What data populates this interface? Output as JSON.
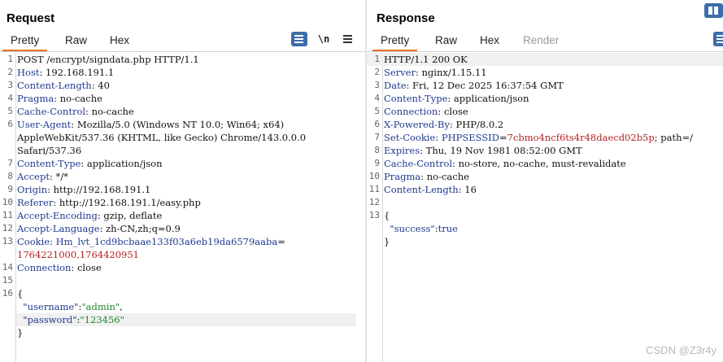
{
  "request": {
    "title": "Request",
    "tabs": [
      "Pretty",
      "Raw",
      "Hex"
    ],
    "newline_toggle": "\\n",
    "lines": [
      {
        "n": "1",
        "segments": [
          {
            "t": "POST /encrypt/signdata.php HTTP/1.1",
            "c": ""
          }
        ]
      },
      {
        "n": "2",
        "segments": [
          {
            "t": "Host",
            "c": "hn"
          },
          {
            "t": ": 192.168.191.1",
            "c": ""
          }
        ]
      },
      {
        "n": "3",
        "segments": [
          {
            "t": "Content-Length",
            "c": "hn"
          },
          {
            "t": ": 40",
            "c": ""
          }
        ]
      },
      {
        "n": "4",
        "segments": [
          {
            "t": "Pragma",
            "c": "hn"
          },
          {
            "t": ": no-cache",
            "c": ""
          }
        ]
      },
      {
        "n": "5",
        "segments": [
          {
            "t": "Cache-Control",
            "c": "hn"
          },
          {
            "t": ": no-cache",
            "c": ""
          }
        ]
      },
      {
        "n": "6",
        "segments": [
          {
            "t": "User-Agent",
            "c": "hn"
          },
          {
            "t": ": Mozilla/5.0 (Windows NT 10.0; Win64; x64)",
            "c": ""
          }
        ]
      },
      {
        "n": "",
        "segments": [
          {
            "t": "AppleWebKit/537.36 (KHTML, like Gecko) Chrome/143.0.0.0",
            "c": ""
          }
        ]
      },
      {
        "n": "",
        "segments": [
          {
            "t": "Safari/537.36",
            "c": ""
          }
        ]
      },
      {
        "n": "7",
        "segments": [
          {
            "t": "Content-Type",
            "c": "hn"
          },
          {
            "t": ": application/json",
            "c": ""
          }
        ]
      },
      {
        "n": "8",
        "segments": [
          {
            "t": "Accept",
            "c": "hn"
          },
          {
            "t": ": */*",
            "c": ""
          }
        ]
      },
      {
        "n": "9",
        "segments": [
          {
            "t": "Origin",
            "c": "hn"
          },
          {
            "t": ": http://192.168.191.1",
            "c": ""
          }
        ]
      },
      {
        "n": "10",
        "segments": [
          {
            "t": "Referer",
            "c": "hn"
          },
          {
            "t": ": http://192.168.191.1/easy.php",
            "c": ""
          }
        ]
      },
      {
        "n": "11",
        "segments": [
          {
            "t": "Accept-Encoding",
            "c": "hn"
          },
          {
            "t": ": gzip, deflate",
            "c": ""
          }
        ]
      },
      {
        "n": "12",
        "segments": [
          {
            "t": "Accept-Language",
            "c": "hn"
          },
          {
            "t": ": zh-CN,zh;q=0.9",
            "c": ""
          }
        ]
      },
      {
        "n": "13",
        "segments": [
          {
            "t": "Cookie",
            "c": "hn"
          },
          {
            "t": ": ",
            "c": ""
          },
          {
            "t": "Hm_lvt_1cd9bcbaae133f03a6eb19da6579aaba",
            "c": "hn"
          },
          {
            "t": "=",
            "c": ""
          }
        ]
      },
      {
        "n": "",
        "segments": [
          {
            "t": "1764221000,1764420951",
            "c": "cv"
          }
        ]
      },
      {
        "n": "14",
        "segments": [
          {
            "t": "Connection",
            "c": "hn"
          },
          {
            "t": ": close",
            "c": ""
          }
        ]
      },
      {
        "n": "15",
        "segments": [
          {
            "t": "",
            "c": ""
          }
        ]
      },
      {
        "n": "16",
        "segments": [
          {
            "t": "{",
            "c": ""
          }
        ]
      },
      {
        "n": "",
        "segments": [
          {
            "t": "  \"username\"",
            "c": "jk"
          },
          {
            "t": ":",
            "c": ""
          },
          {
            "t": "\"admin\"",
            "c": "jv"
          },
          {
            "t": ",",
            "c": ""
          }
        ]
      },
      {
        "n": "",
        "highlight": true,
        "segments": [
          {
            "t": "  \"password\"",
            "c": "jk"
          },
          {
            "t": ":",
            "c": ""
          },
          {
            "t": "\"123456\"",
            "c": "jv"
          }
        ]
      },
      {
        "n": "",
        "segments": [
          {
            "t": "}",
            "c": ""
          }
        ]
      }
    ]
  },
  "response": {
    "title": "Response",
    "tabs": [
      "Pretty",
      "Raw",
      "Hex",
      "Render"
    ],
    "lines": [
      {
        "n": "1",
        "highlight": true,
        "segments": [
          {
            "t": "HTTP/1.1 200 OK",
            "c": ""
          }
        ]
      },
      {
        "n": "2",
        "segments": [
          {
            "t": "Server",
            "c": "hn"
          },
          {
            "t": ": nginx/1.15.11",
            "c": ""
          }
        ]
      },
      {
        "n": "3",
        "segments": [
          {
            "t": "Date",
            "c": "hn"
          },
          {
            "t": ": Fri, 12 Dec 2025 16:37:54 GMT",
            "c": ""
          }
        ]
      },
      {
        "n": "4",
        "segments": [
          {
            "t": "Content-Type",
            "c": "hn"
          },
          {
            "t": ": application/json",
            "c": ""
          }
        ]
      },
      {
        "n": "5",
        "segments": [
          {
            "t": "Connection",
            "c": "hn"
          },
          {
            "t": ": close",
            "c": ""
          }
        ]
      },
      {
        "n": "6",
        "segments": [
          {
            "t": "X-Powered-By",
            "c": "hn"
          },
          {
            "t": ": PHP/8.0.2",
            "c": ""
          }
        ]
      },
      {
        "n": "7",
        "segments": [
          {
            "t": "Set-Cookie",
            "c": "hn"
          },
          {
            "t": ": ",
            "c": ""
          },
          {
            "t": "PHPSESSID",
            "c": "hn"
          },
          {
            "t": "=",
            "c": ""
          },
          {
            "t": "7cbmo4ncf6ts4r48daecd02b5p",
            "c": "cv"
          },
          {
            "t": "; path=/",
            "c": ""
          }
        ]
      },
      {
        "n": "8",
        "segments": [
          {
            "t": "Expires",
            "c": "hn"
          },
          {
            "t": ": Thu, 19 Nov 1981 08:52:00 GMT",
            "c": ""
          }
        ]
      },
      {
        "n": "9",
        "segments": [
          {
            "t": "Cache-Control",
            "c": "hn"
          },
          {
            "t": ": no-store, no-cache, must-revalidate",
            "c": ""
          }
        ]
      },
      {
        "n": "10",
        "segments": [
          {
            "t": "Pragma",
            "c": "hn"
          },
          {
            "t": ": no-cache",
            "c": ""
          }
        ]
      },
      {
        "n": "11",
        "segments": [
          {
            "t": "Content-Length",
            "c": "hn"
          },
          {
            "t": ": 16",
            "c": ""
          }
        ]
      },
      {
        "n": "12",
        "segments": [
          {
            "t": "",
            "c": ""
          }
        ]
      },
      {
        "n": "13",
        "segments": [
          {
            "t": "{",
            "c": ""
          }
        ]
      },
      {
        "n": "",
        "segments": [
          {
            "t": "  \"success\"",
            "c": "jk"
          },
          {
            "t": ":",
            "c": ""
          },
          {
            "t": "true",
            "c": "hn"
          }
        ]
      },
      {
        "n": "",
        "segments": [
          {
            "t": "}",
            "c": ""
          }
        ]
      }
    ]
  },
  "watermark": "CSDN @Z3r4y",
  "colors": {
    "accent": "#e8712a",
    "header_name": "#1f3a8f",
    "json_value": "#1b8a2e",
    "cookie_value": "#b22222",
    "button": "#3d6da9"
  }
}
